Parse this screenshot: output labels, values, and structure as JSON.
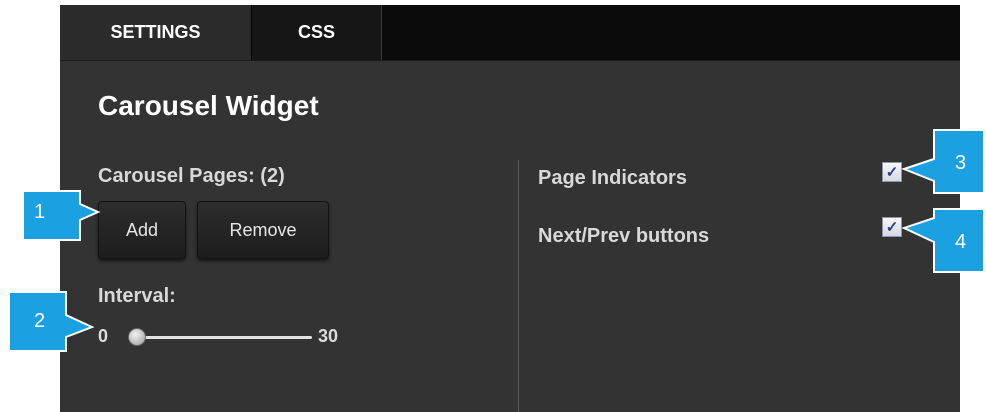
{
  "tabs": {
    "settings": "SETTINGS",
    "css": "CSS"
  },
  "widget_title": "Carousel Widget",
  "carousel_pages": {
    "label": "Carousel Pages: (2)",
    "add_button": "Add",
    "remove_button": "Remove"
  },
  "interval": {
    "label": "Interval:",
    "min": "0",
    "max": "30",
    "value": 0
  },
  "options": {
    "page_indicators": {
      "label": "Page Indicators",
      "checked": true
    },
    "next_prev_buttons": {
      "label": "Next/Prev buttons",
      "checked": true
    }
  },
  "callouts": [
    "1",
    "2",
    "3",
    "4"
  ],
  "colors": {
    "callout": "#1ba1e2",
    "panel": "#333333",
    "tabbar": "#0b0b0b"
  }
}
